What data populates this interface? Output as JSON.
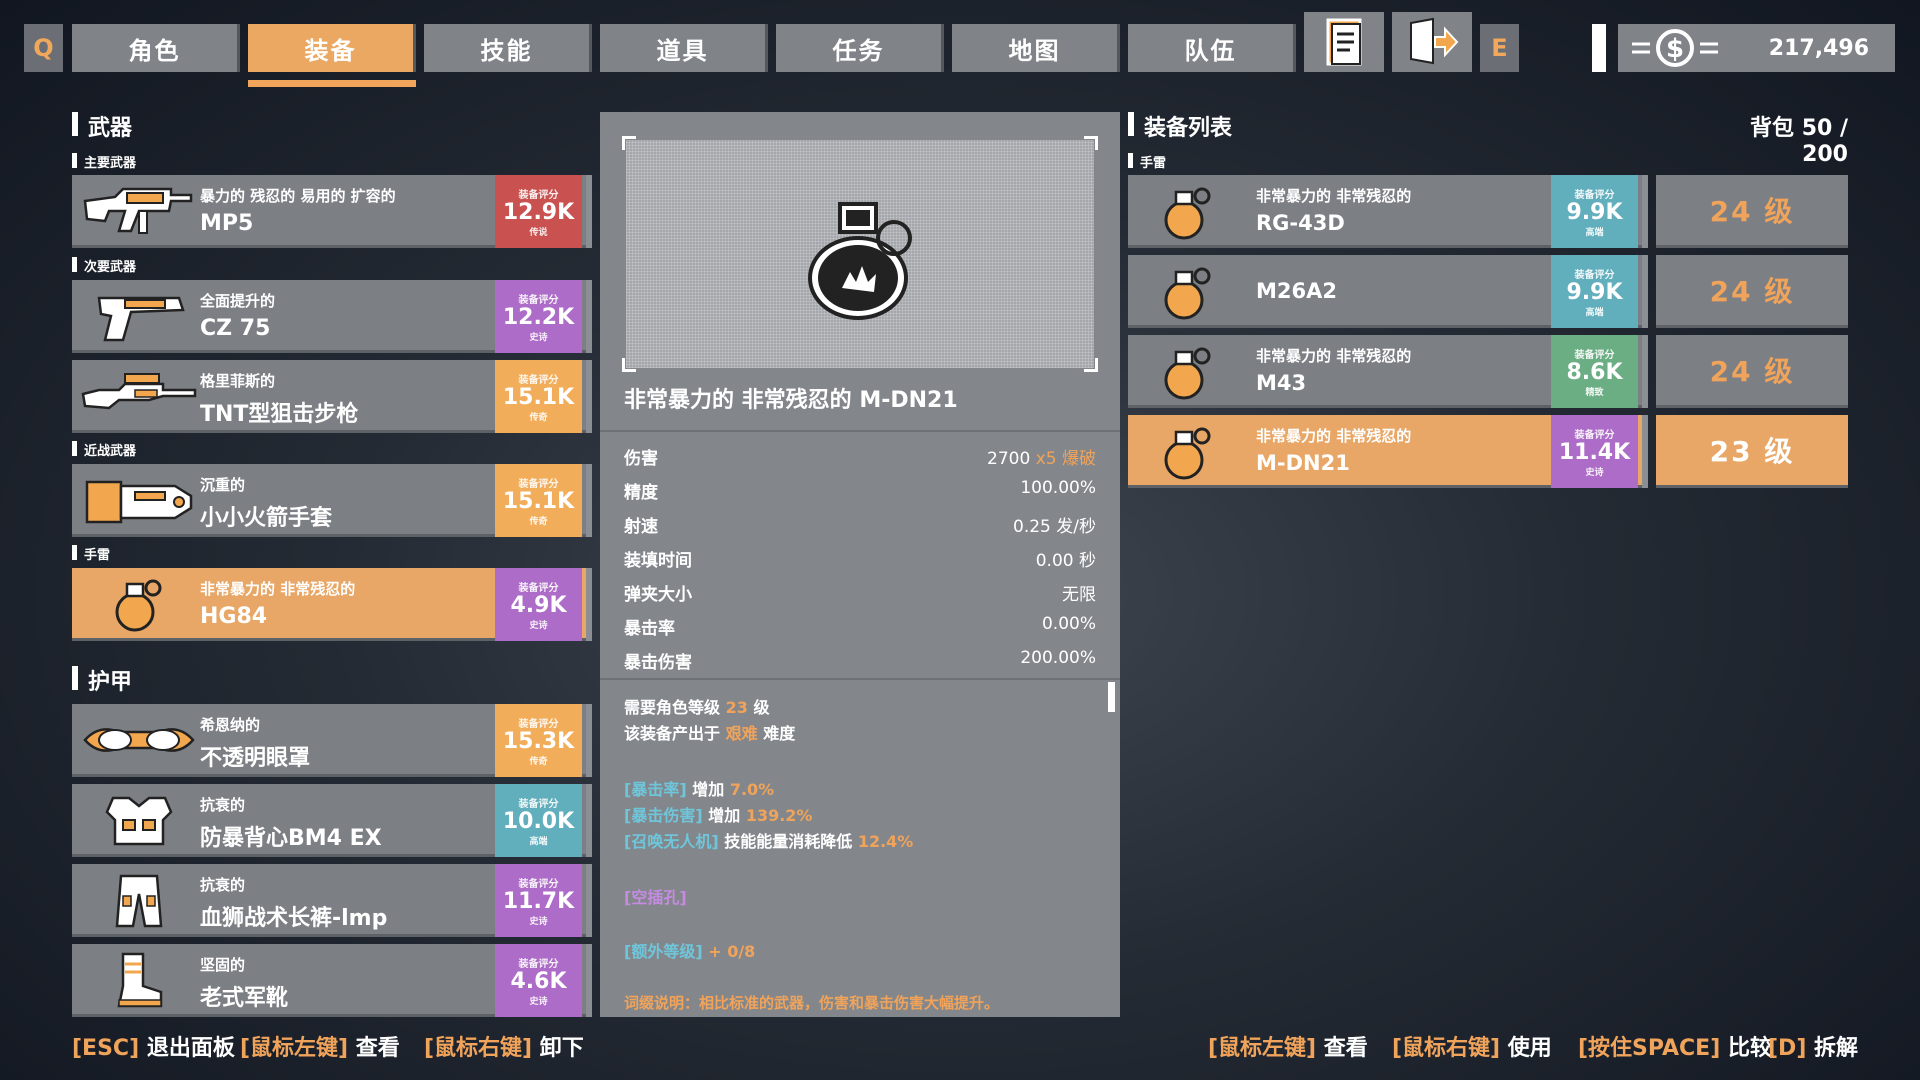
{
  "topbar": {
    "key_left": "Q",
    "key_right": "E",
    "tabs": [
      "角色",
      "装备",
      "技能",
      "道具",
      "任务",
      "地图",
      "队伍"
    ],
    "active_tab": "装备",
    "currency": "217,496"
  },
  "left": {
    "weapons_title": "武器",
    "primary_label": "主要武器",
    "secondary_label": "次要武器",
    "melee_label": "近战武器",
    "grenade_label": "手雷",
    "armor_title": "护甲",
    "score_caption": "装备评分",
    "items": [
      {
        "l1": "暴力的 残忍的 易用的 扩容的",
        "l2": "MP5",
        "score": "12.9K",
        "rarity": "传说",
        "color": "#c9514f"
      },
      {
        "l1": "全面提升的",
        "l2": "CZ 75",
        "score": "12.2K",
        "rarity": "史诗",
        "color": "#ad6cc7"
      },
      {
        "l1": "格里菲斯的",
        "l2": "TNT型狙击步枪",
        "score": "15.1K",
        "rarity": "传奇",
        "color": "#f2ad5b"
      },
      {
        "l1": "沉重的",
        "l2": "小小火箭手套",
        "score": "15.1K",
        "rarity": "传奇",
        "color": "#f2ad5b"
      },
      {
        "l1": "非常暴力的 非常残忍的",
        "l2": "HG84",
        "score": "4.9K",
        "rarity": "史诗",
        "color": "#ad6cc7"
      },
      {
        "l1": "希恩纳的",
        "l2": "不透明眼罩",
        "score": "15.3K",
        "rarity": "传奇",
        "color": "#f2ad5b"
      },
      {
        "l1": "抗衰的",
        "l2": "防暴背心BM4 EX",
        "score": "10.0K",
        "rarity": "高端",
        "color": "#61aebd"
      },
      {
        "l1": "抗衰的",
        "l2": "血狮战术长裤-lmp",
        "score": "11.7K",
        "rarity": "史诗",
        "color": "#ad6cc7"
      },
      {
        "l1": "坚固的",
        "l2": "老式军靴",
        "score": "4.6K",
        "rarity": "史诗",
        "color": "#ad6cc7"
      }
    ]
  },
  "center": {
    "title": "非常暴力的 非常残忍的 M-DN21",
    "stats": [
      {
        "k": "伤害",
        "v": "2700",
        "extra1": "x5",
        "extra2": "爆破"
      },
      {
        "k": "精度",
        "v": "100.00%"
      },
      {
        "k": "射速",
        "v": "0.25 发/秒"
      },
      {
        "k": "装填时间",
        "v": "0.00 秒"
      },
      {
        "k": "弹夹大小",
        "v": "无限"
      },
      {
        "k": "暴击率",
        "v": "0.00%"
      },
      {
        "k": "暴击伤害",
        "v": "200.00%"
      }
    ],
    "req_prefix": "需要角色等级",
    "req_level": "23",
    "req_suffix": "级",
    "src_prefix": "该装备产出于",
    "src_diff": "艰难",
    "src_suffix": "难度",
    "affixes": [
      {
        "tag": "[暴击率]",
        "text": "增加",
        "val": "7.0%"
      },
      {
        "tag": "[暴击伤害]",
        "text": "增加",
        "val": "139.2%"
      },
      {
        "tag": "[召唤无人机]",
        "text": "技能能量消耗降低",
        "val": "12.4%"
      }
    ],
    "socket": "[空插孔]",
    "extra_tag": "[额外等级]",
    "extra_val": "+ 0/8",
    "note": "词缀说明：相比标准的武器，伤害和暴击伤害大幅提升。"
  },
  "right": {
    "title": "装备列表",
    "bag_label": "背包",
    "bag_value": "50 / 200",
    "grenade_label": "手雷",
    "score_caption": "装备评分",
    "items": [
      {
        "l1": "非常暴力的 非常残忍的",
        "l2": "RG-43D",
        "score": "9.9K",
        "rarity": "高端",
        "color": "#61aebd",
        "level": "24 级"
      },
      {
        "l1": "",
        "l2": "M26A2",
        "score": "9.9K",
        "rarity": "高端",
        "color": "#61aebd",
        "level": "24 级"
      },
      {
        "l1": "非常暴力的 非常残忍的",
        "l2": "M43",
        "score": "8.6K",
        "rarity": "精致",
        "color": "#6cae84",
        "level": "24 级"
      },
      {
        "l1": "非常暴力的 非常残忍的",
        "l2": "M-DN21",
        "score": "11.4K",
        "rarity": "史诗",
        "color": "#ad6cc7",
        "level": "23 级"
      }
    ]
  },
  "hints_left": [
    {
      "k": "[ESC]",
      "t": "退出面板"
    },
    {
      "k": "[鼠标左键]",
      "t": "查看"
    },
    {
      "k": "[鼠标右键]",
      "t": "卸下"
    }
  ],
  "hints_right": [
    {
      "k": "[鼠标左键]",
      "t": "查看"
    },
    {
      "k": "[鼠标右键]",
      "t": "使用"
    },
    {
      "k": "[按住SPACE]",
      "t": "比较"
    },
    {
      "k": "[D]",
      "t": "拆解"
    }
  ]
}
